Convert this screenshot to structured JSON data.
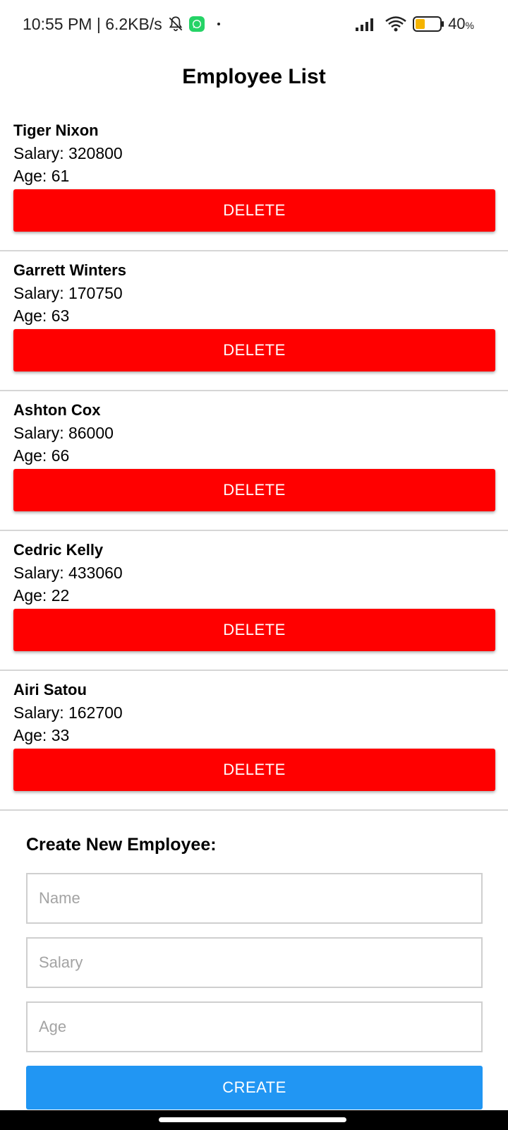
{
  "status_bar": {
    "time_speed": "10:55 PM | 6.2KB/s",
    "battery_value": "40",
    "battery_unit": "%"
  },
  "header": {
    "title": "Employee List"
  },
  "employees": [
    {
      "name": "Tiger Nixon",
      "salary": "Salary: 320800",
      "age": "Age: 61",
      "delete_label": "DELETE"
    },
    {
      "name": "Garrett Winters",
      "salary": "Salary: 170750",
      "age": "Age: 63",
      "delete_label": "DELETE"
    },
    {
      "name": "Ashton Cox",
      "salary": "Salary: 86000",
      "age": "Age: 66",
      "delete_label": "DELETE"
    },
    {
      "name": "Cedric Kelly",
      "salary": "Salary: 433060",
      "age": "Age: 22",
      "delete_label": "DELETE"
    },
    {
      "name": "Airi Satou",
      "salary": "Salary: 162700",
      "age": "Age: 33",
      "delete_label": "DELETE"
    }
  ],
  "create_form": {
    "title": "Create New Employee:",
    "name_placeholder": "Name",
    "salary_placeholder": "Salary",
    "age_placeholder": "Age",
    "name_value": "",
    "salary_value": "",
    "age_value": "",
    "create_label": "CREATE"
  },
  "colors": {
    "delete_button": "#ff0000",
    "create_button": "#2196F3",
    "whatsapp": "#25D366",
    "battery_fill": "#F5B400"
  },
  "icons": [
    "mute-bell-icon",
    "whatsapp-icon",
    "signal-icon",
    "wifi-icon",
    "battery-icon"
  ]
}
